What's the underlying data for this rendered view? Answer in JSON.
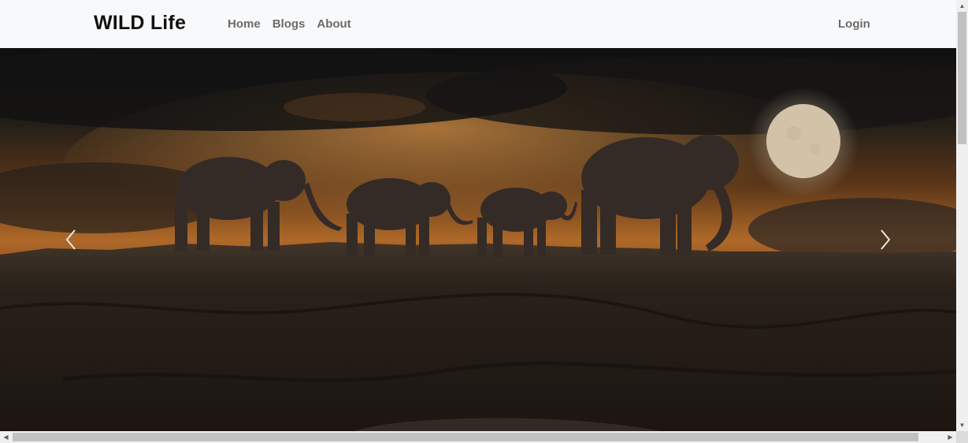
{
  "navbar": {
    "brand": "WILD Life",
    "links": [
      "Home",
      "Blogs",
      "About"
    ],
    "login": "Login"
  },
  "hero": {
    "image": "elephants-silhouette-moonrise",
    "prev_icon": "chevron-left-icon",
    "next_icon": "chevron-right-icon"
  },
  "colors": {
    "navbar_bg": "#f8f9fa",
    "brand_text": "#111111",
    "nav_link_text": "#6b6b6b",
    "sky_glow": "#d9883a",
    "moon": "#f3e6cf"
  }
}
